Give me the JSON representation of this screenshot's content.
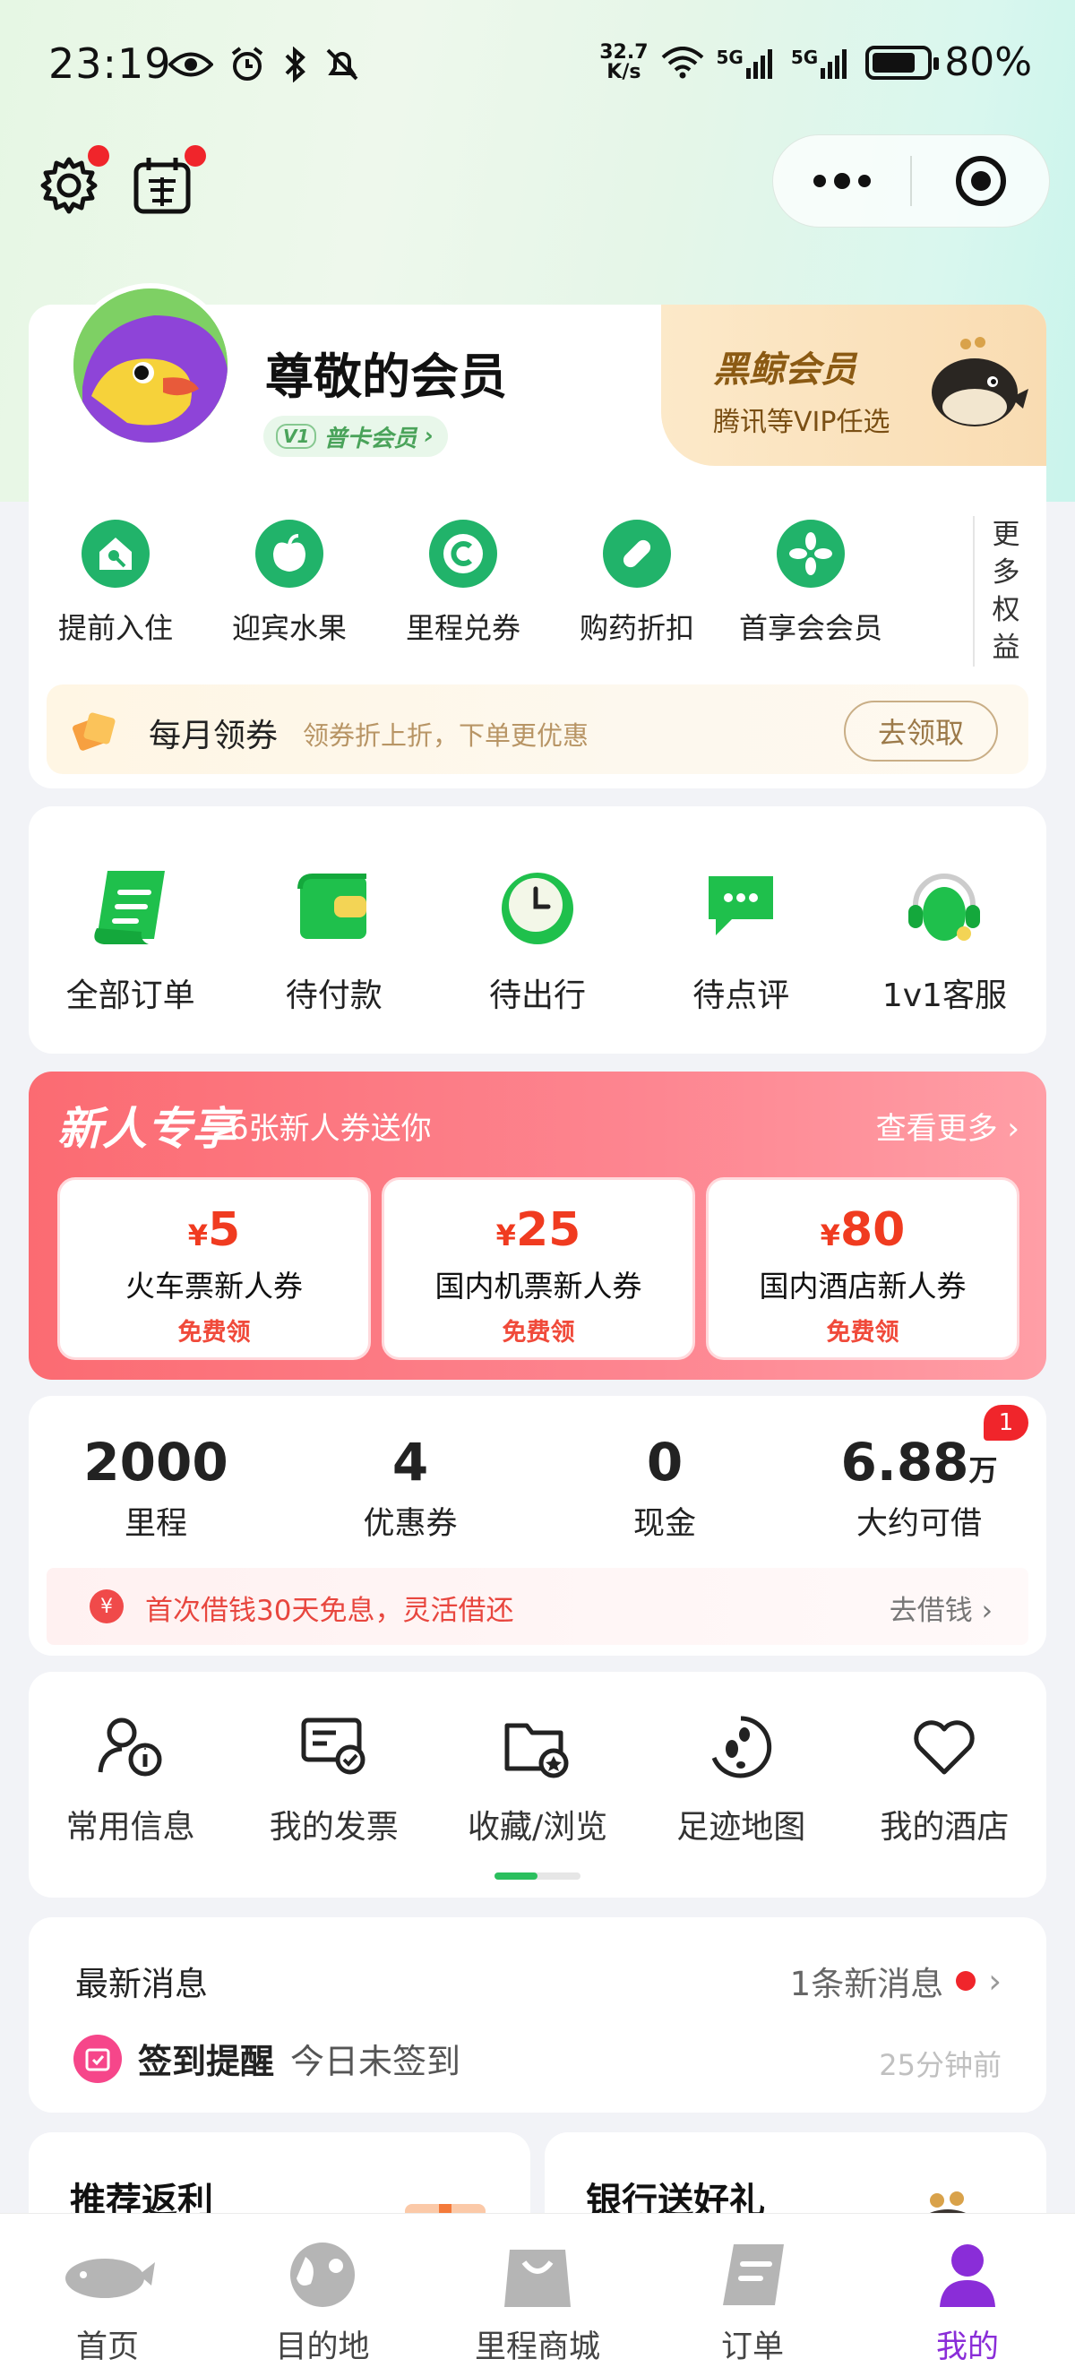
{
  "status_bar": {
    "time": "23:19",
    "net_speed_value": "32.7",
    "net_speed_unit": "K/s",
    "signal_1": "5G",
    "signal_2": "5G",
    "battery": "80%",
    "battery_level": 0.8
  },
  "top": {
    "settings_icon": "gear-icon",
    "checkin_icon": "sign-in-calendar-icon",
    "capsule_more": "more-dots-icon",
    "capsule_close": "target-icon"
  },
  "member": {
    "name": "尊敬的会员",
    "level_badge": "V1",
    "level": "普卡会员",
    "vip_title": "黑鲸会员",
    "vip_subtitle": "腾讯等VIP任选",
    "benefits": [
      {
        "label": "提前入住",
        "icon": "house-key-icon"
      },
      {
        "label": "迎宾水果",
        "icon": "apple-icon"
      },
      {
        "label": "里程兑券",
        "icon": "coin-c-icon"
      },
      {
        "label": "购药折扣",
        "icon": "pill-icon"
      },
      {
        "label": "首享会会员",
        "icon": "flower-icon"
      }
    ],
    "more_benefits": "更多权益",
    "coupon_bar": {
      "title": "每月领券",
      "subtitle": "领券折上折，下单更优惠",
      "button": "去领取"
    }
  },
  "orders": [
    {
      "label": "全部订单",
      "icon": "order-list-icon"
    },
    {
      "label": "待付款",
      "icon": "wallet-icon"
    },
    {
      "label": "待出行",
      "icon": "clock-icon"
    },
    {
      "label": "待点评",
      "icon": "chat-bubble-icon"
    },
    {
      "label": "1v1客服",
      "icon": "headset-icon"
    }
  ],
  "new_user": {
    "title": "新人专享",
    "subtitle": "6张新人券送你",
    "more": "查看更多",
    "coupons": [
      {
        "currency": "¥",
        "amount": "5",
        "name": "火车票新人券",
        "action": "免费领"
      },
      {
        "currency": "¥",
        "amount": "25",
        "name": "国内机票新人券",
        "action": "免费领"
      },
      {
        "currency": "¥",
        "amount": "80",
        "name": "国内酒店新人券",
        "action": "免费领"
      }
    ]
  },
  "assets": {
    "items": [
      {
        "value": "2000",
        "unit": "",
        "label": "里程"
      },
      {
        "value": "4",
        "unit": "",
        "label": "优惠券"
      },
      {
        "value": "0",
        "unit": "",
        "label": "现金"
      },
      {
        "value": "6.88",
        "unit": "万",
        "label": "大约可借"
      }
    ],
    "badge": "1",
    "loan_icon": "¥",
    "loan_text": "首次借钱30天免息，灵活借还",
    "loan_action": "去借钱"
  },
  "tools": [
    {
      "label": "常用信息",
      "icon": "person-info-icon"
    },
    {
      "label": "我的发票",
      "icon": "invoice-icon"
    },
    {
      "label": "收藏/浏览",
      "icon": "folder-star-icon"
    },
    {
      "label": "足迹地图",
      "icon": "footprint-icon"
    },
    {
      "label": "我的酒店",
      "icon": "heart-icon"
    }
  ],
  "messages": {
    "title": "最新消息",
    "count_text": "1条新消息",
    "item_title": "签到提醒",
    "item_text": "今日未签到",
    "item_time": "25分钟前"
  },
  "promos": [
    {
      "title": "推荐返利"
    },
    {
      "title": "银行送好礼"
    }
  ],
  "tabbar": [
    {
      "label": "首页",
      "icon": "whale-icon",
      "active": false
    },
    {
      "label": "目的地",
      "icon": "globe-icon",
      "active": false
    },
    {
      "label": "里程商城",
      "icon": "shopping-bag-icon",
      "active": false
    },
    {
      "label": "订单",
      "icon": "order-icon",
      "active": false
    },
    {
      "label": "我的",
      "icon": "user-icon",
      "active": true
    }
  ],
  "colors": {
    "accent_green": "#21b36a",
    "active_tab": "#8a2dd8",
    "coupon_red": "#f03b20"
  }
}
